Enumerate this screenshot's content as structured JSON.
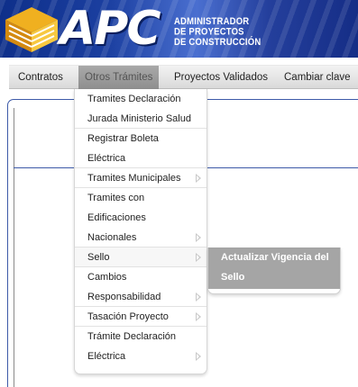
{
  "banner": {
    "logo": "APC",
    "subtitle_lines": [
      "ADMINISTRADOR",
      "DE PROYECTOS",
      "DE CONSTRUCCIÓN"
    ]
  },
  "menubar": {
    "items": [
      {
        "label": "Contratos"
      },
      {
        "label": "Otros Trámites"
      },
      {
        "label": "Proyectos Validados"
      },
      {
        "label": "Cambiar clave"
      }
    ],
    "active": "Otros Trámites"
  },
  "dropdown": {
    "items": [
      {
        "lines": [
          "Tramites Declaración",
          "Jurada Ministerio Salud"
        ],
        "has_submenu": false
      },
      {
        "lines": [
          "Registrar Boleta",
          "Eléctrica"
        ],
        "has_submenu": false
      },
      {
        "lines": [
          "Tramites Municipales"
        ],
        "has_submenu": true
      },
      {
        "lines": [
          "Tramites con",
          "Edificaciones",
          "Nacionales"
        ],
        "has_submenu": true
      },
      {
        "lines": [
          "Sello"
        ],
        "has_submenu": true
      },
      {
        "lines": [
          "Cambios",
          "Responsabilidad"
        ],
        "has_submenu": true
      },
      {
        "lines": [
          "Tasación Proyecto"
        ],
        "has_submenu": true
      },
      {
        "lines": [
          "Trámite Declaración",
          "Eléctrica"
        ],
        "has_submenu": true
      }
    ]
  },
  "submenu": {
    "parent": "Sello",
    "items": [
      {
        "lines": [
          "Actualizar Vigencia del",
          "Sello"
        ]
      }
    ]
  },
  "colors": {
    "banner_blue": "#1b3fa0",
    "menu_active": "#999999",
    "submenu_highlight": "#a5a5a5",
    "frame_blue": "#3d5aa8"
  }
}
